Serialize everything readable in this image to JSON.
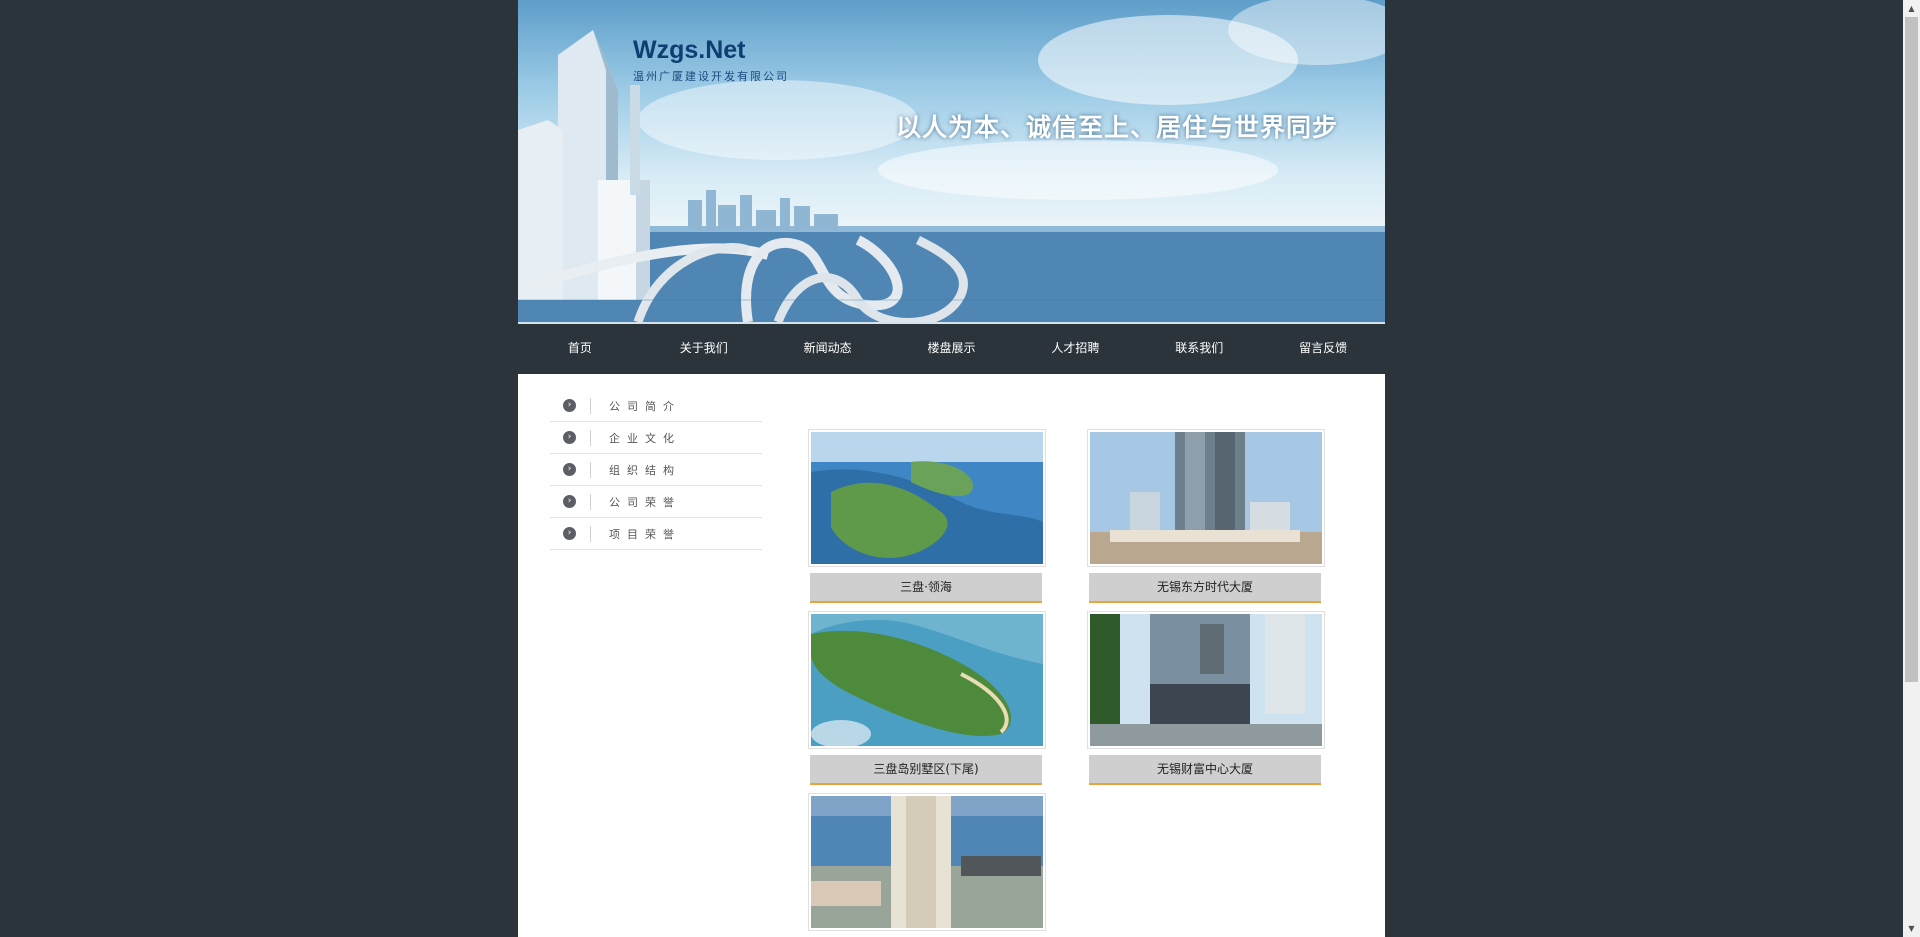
{
  "banner": {
    "logo_main": "Wzgs.Net",
    "logo_sub": "温州广厦建设开发有限公司",
    "slogan": "以人为本、诚信至上、居住与世界同步"
  },
  "nav": {
    "items": [
      "首页",
      "关于我们",
      "新闻动态",
      "楼盘展示",
      "人才招聘",
      "联系我们",
      "留言反馈"
    ]
  },
  "sidebar": {
    "items": [
      "公司简介",
      "企业文化",
      "组织结构",
      "公司荣誉",
      "项目荣誉"
    ]
  },
  "projects": [
    {
      "caption": "三盘·领海"
    },
    {
      "caption": "无锡东方时代大厦"
    },
    {
      "caption": "三盘岛别墅区(下尾)"
    },
    {
      "caption": "无锡财富中心大厦"
    },
    {
      "caption": ""
    }
  ],
  "colors": {
    "page_bg": "#2b343a",
    "content_bg": "#ffffff",
    "nav_bg": "#2b343a",
    "caption_bg": "#cfcfcf",
    "caption_accent": "#e8a33a"
  }
}
